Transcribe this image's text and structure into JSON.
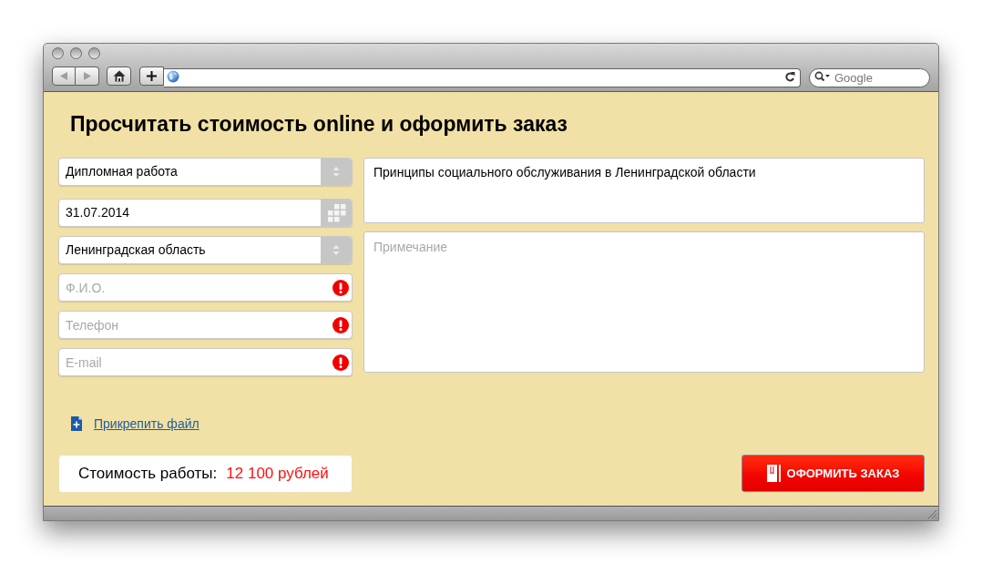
{
  "browser": {
    "nav_buttons": [
      {
        "kind": "back",
        "disabled": true
      },
      {
        "kind": "forward",
        "disabled": true
      }
    ],
    "search": {
      "placeholder": "Google"
    }
  },
  "page": {
    "title": "Просчитать стоимость online и оформить заказ",
    "fields": [
      {
        "kind": "select",
        "value": "Дипломная работа"
      },
      {
        "kind": "date",
        "value": "31.07.2014"
      },
      {
        "kind": "select",
        "value": "Ленинградская область"
      },
      {
        "kind": "text",
        "placeholder": "Ф.И.О.",
        "invalid": true
      },
      {
        "kind": "text",
        "placeholder": "Телефон",
        "invalid": true
      },
      {
        "kind": "text",
        "placeholder": "E-mail",
        "invalid": true
      }
    ],
    "topic": {
      "value": "Принципы социального обслуживания в Ленинградской области"
    },
    "note": {
      "placeholder": "Примечание"
    },
    "attach_link": {
      "label": "Прикрепить файл"
    },
    "price": {
      "label": "Стоимость работы:",
      "value": "12 100 рублей"
    },
    "submit_button": {
      "label": "ОФОРМИТЬ ЗАКАЗ"
    }
  }
}
